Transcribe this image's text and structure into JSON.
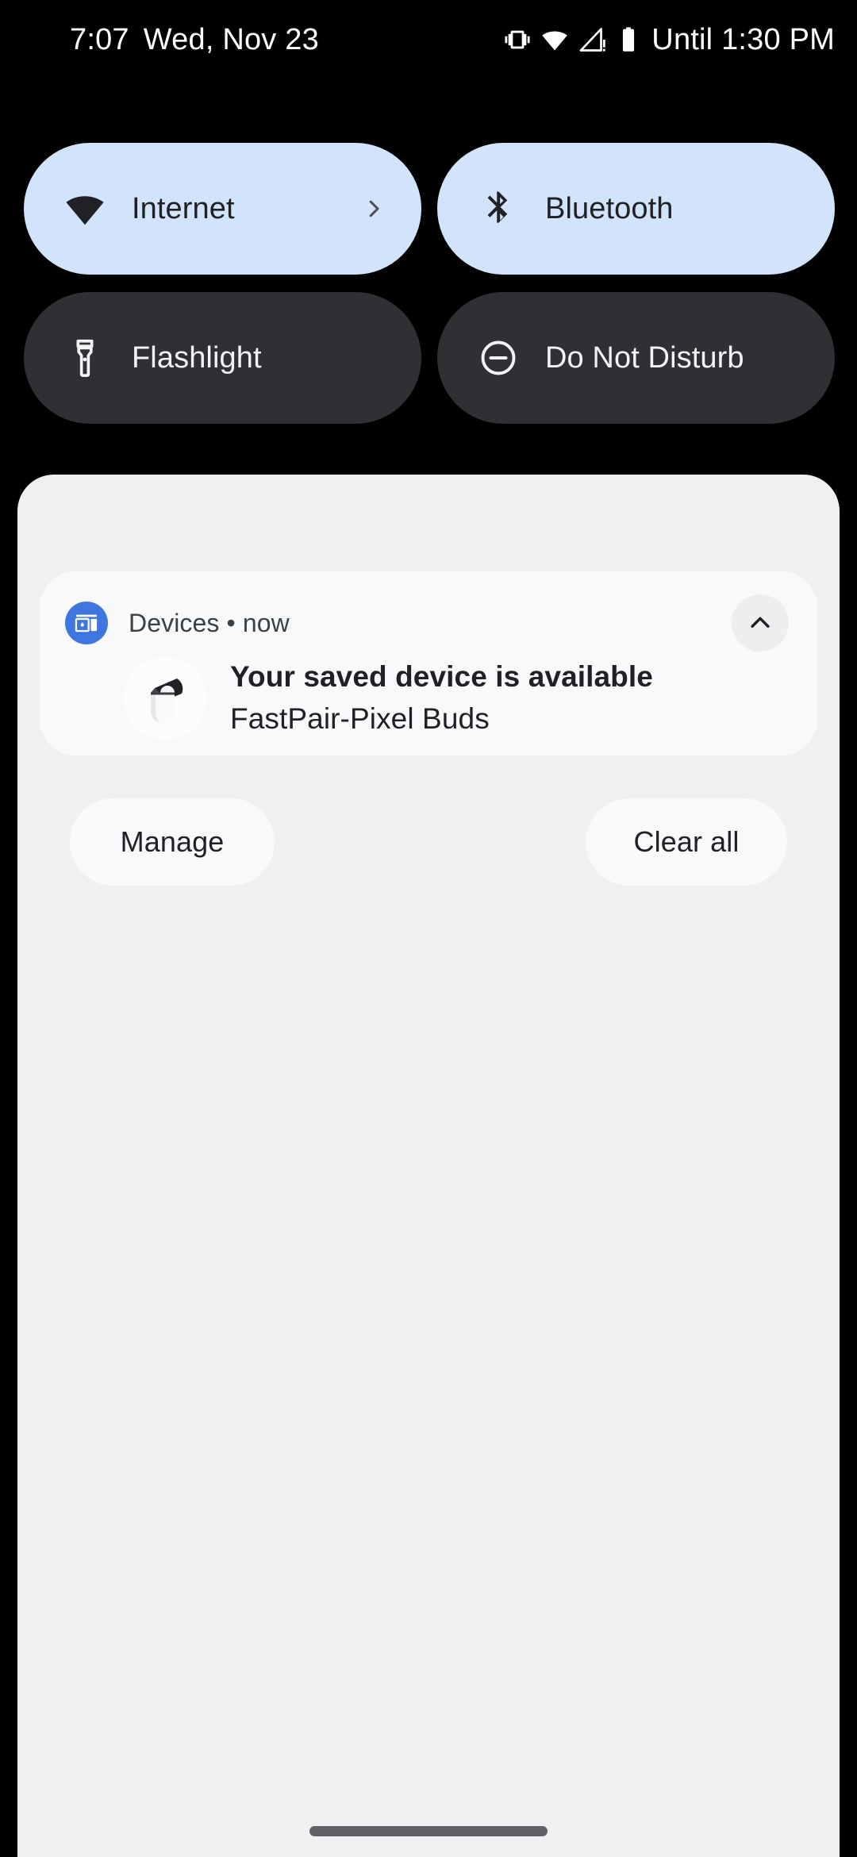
{
  "status_bar": {
    "clock": "7:07",
    "date": "Wed, Nov 23",
    "icons": [
      "vibrate-icon",
      "wifi-icon",
      "cellular-signal-warning-icon",
      "battery-icon"
    ],
    "dnd_until": "Until 1:30 PM"
  },
  "quick_settings": {
    "tiles": [
      {
        "label": "Internet",
        "icon": "wifi-icon",
        "state": "active",
        "has_chevron": true
      },
      {
        "label": "Bluetooth",
        "icon": "bluetooth-icon",
        "state": "active",
        "has_chevron": false
      },
      {
        "label": "Flashlight",
        "icon": "flashlight-icon",
        "state": "inactive",
        "has_chevron": false
      },
      {
        "label": "Do Not Disturb",
        "icon": "do-not-disturb-icon",
        "state": "inactive",
        "has_chevron": false
      }
    ],
    "active_color": "#D2E3FC",
    "inactive_color": "#2E3033"
  },
  "notification_shade": {
    "background_color": "#F0F0F2",
    "notification": {
      "app_name": "Devices",
      "separator": "•",
      "time": "now",
      "app_icon": "devices-cast-icon",
      "app_icon_color": "#3F75DE",
      "device_image": "pixel-buds-case-image",
      "title": "Your saved device is available",
      "subtitle": "FastPair-Pixel Buds",
      "collapse_icon": "chevron-up-icon"
    },
    "actions": {
      "manage_label": "Manage",
      "clear_all_label": "Clear all"
    }
  },
  "navigation": {
    "handle": "gesture-nav-handle"
  }
}
